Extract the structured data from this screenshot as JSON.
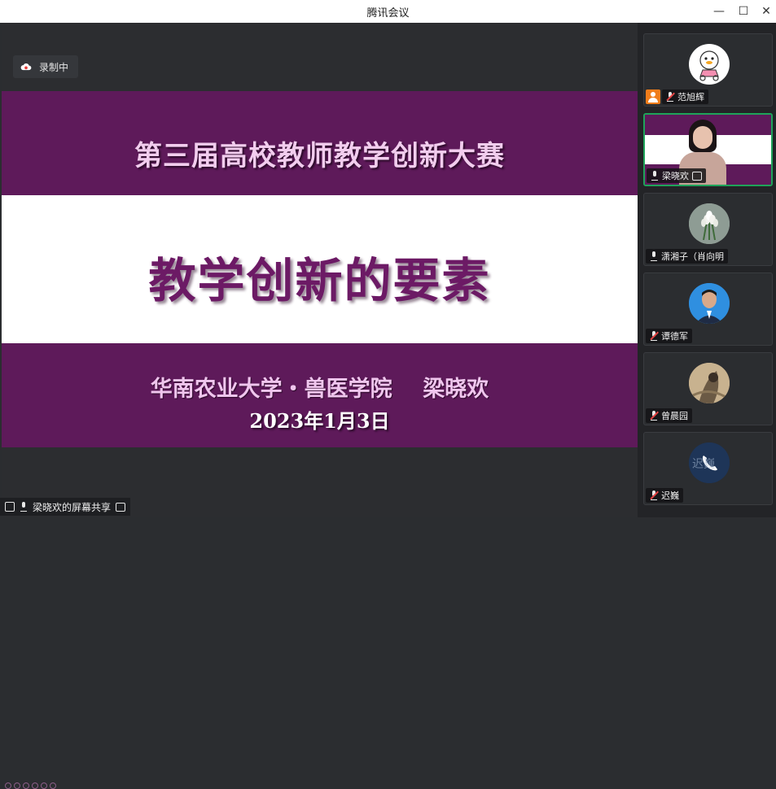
{
  "window": {
    "title": "腾讯会议"
  },
  "recording": {
    "label": "录制中"
  },
  "slide": {
    "title": "第三届高校教师教学创新大赛",
    "heading": "教学创新的要素",
    "affiliation": "华南农业大学・兽医学院    梁晓欢",
    "date": "2023年1月3日"
  },
  "share_bar": {
    "label": "梁晓欢的屏幕共享"
  },
  "participants": [
    {
      "name": "范旭辉",
      "muted": true,
      "host": true,
      "avatar": "cartoon-duck"
    },
    {
      "name": "梁晓欢",
      "muted": false,
      "video": true,
      "sharing": true
    },
    {
      "name": "潇湘子（肖向明",
      "muted": false,
      "avatar": "flowers"
    },
    {
      "name": "谭德军",
      "muted": true,
      "avatar": "photo"
    },
    {
      "name": "曾晨园",
      "muted": true,
      "avatar": "photo"
    },
    {
      "name": "迟巍",
      "muted": true,
      "avatar": "phone",
      "avatar_text": "迟巍"
    }
  ],
  "colors": {
    "slide_purple": "#5e1a5a",
    "active_border": "#1fa35a",
    "host_badge": "#f07d1a"
  }
}
